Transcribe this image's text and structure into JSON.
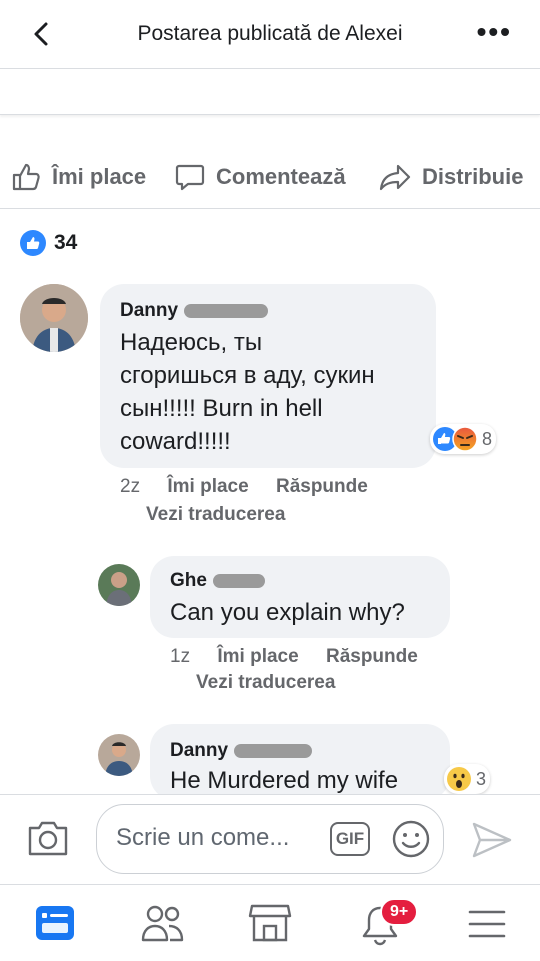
{
  "header": {
    "title": "Postarea publicată de Alexei"
  },
  "actions": {
    "like": "Îmi place",
    "comment": "Comentează",
    "share": "Distribuie"
  },
  "reactions": {
    "count": "34"
  },
  "comments": [
    {
      "author": "Danny",
      "text_lines": [
        "Надеюсь, ты",
        "сгоришься в аду, сукин",
        "сын!!!!! Burn in hell",
        "coward!!!!!"
      ],
      "reaction_count": "8",
      "time": "2z",
      "like": "Îmi place",
      "reply": "Răspunde",
      "translate": "Vezi traducerea"
    },
    {
      "author": "Ghe",
      "text_lines": [
        "Can you explain why?"
      ],
      "time": "1z",
      "like": "Îmi place",
      "reply": "Răspunde",
      "translate": "Vezi traducerea"
    },
    {
      "author": "Danny",
      "text_lines": [
        "He Murdered my wife"
      ],
      "reaction_count": "3"
    }
  ],
  "composer": {
    "placeholder": "Scrie un come...",
    "gif": "GIF"
  },
  "nav": {
    "notifications_badge": "9+"
  },
  "colors": {
    "blue": "#2d88ff",
    "bubble": "#f0f2f5",
    "gray_text": "#65676b",
    "badge_red": "#e41e3f",
    "angry": "#f5a623"
  }
}
